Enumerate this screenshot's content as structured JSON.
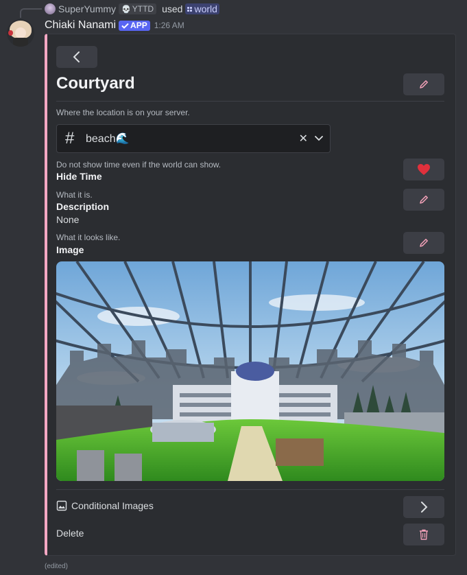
{
  "reply": {
    "user": "SuperYummy",
    "tag": "YTTD",
    "used": "used",
    "command": "world"
  },
  "message": {
    "username": "Chiaki Nanami",
    "badge": "APP",
    "timestamp": "1:26 AM",
    "edited": "(edited)"
  },
  "embed": {
    "title": "Courtyard",
    "location": {
      "hint": "Where the location is on your server.",
      "channel": "beach🌊"
    },
    "hide_time": {
      "hint": "Do not show time even if the world can show.",
      "label": "Hide Time"
    },
    "description": {
      "hint": "What it is.",
      "label": "Description",
      "value": "None"
    },
    "image": {
      "hint": "What it looks like.",
      "label": "Image"
    },
    "conditional_images": "Conditional Images",
    "delete": "Delete"
  },
  "icons": {
    "back": "chevron-left-icon",
    "edit": "pencil-icon",
    "heart": "heart-icon",
    "channel": "hash-icon",
    "clear": "close-icon",
    "dropdown": "chevron-down-icon",
    "image": "image-icon",
    "next": "chevron-right-icon",
    "trash": "trash-icon"
  },
  "colors": {
    "accent_bar": "#f4a7c3",
    "heart": "#e0303c",
    "app_badge": "#5865f2",
    "background": "#313338",
    "embed_bg": "#2b2d31"
  }
}
